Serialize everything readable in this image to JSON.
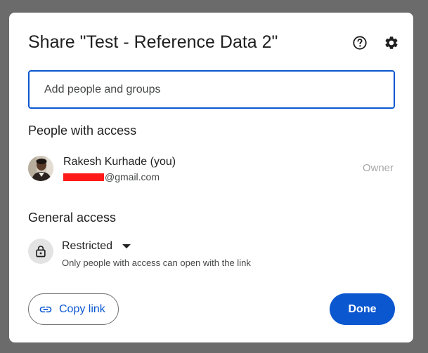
{
  "dialog": {
    "title": "Share \"Test - Reference Data 2\"",
    "help_icon": "help-circle-icon",
    "settings_icon": "gear-icon"
  },
  "search": {
    "placeholder": "Add people and groups",
    "value": ""
  },
  "people_with_access": {
    "heading": "People with access",
    "people": [
      {
        "name": "Rakesh Kurhade (you)",
        "email_suffix": "@gmail.com",
        "role": "Owner"
      }
    ]
  },
  "general_access": {
    "heading": "General access",
    "selected": "Restricted",
    "description": "Only people with access can open with the link",
    "icon": "lock-icon"
  },
  "footer": {
    "copy_link_label": "Copy link",
    "copy_link_icon": "link-icon",
    "done_label": "Done"
  },
  "colors": {
    "accent": "#0b57d0",
    "backdrop": "#6b6b6b",
    "redaction": "#ff1a1a"
  }
}
